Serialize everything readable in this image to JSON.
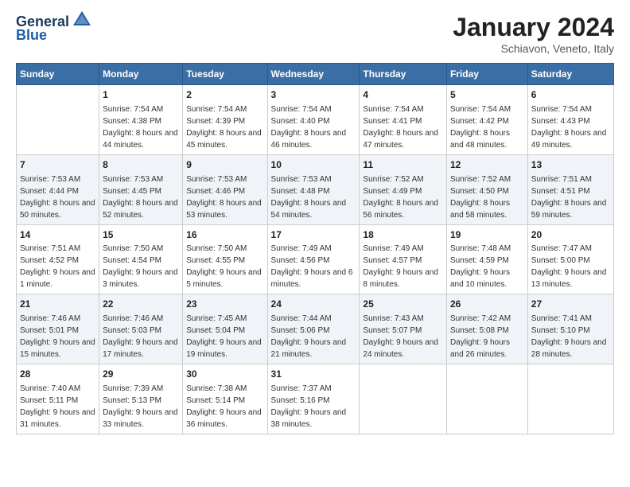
{
  "logo": {
    "line1": "General",
    "line2": "Blue"
  },
  "title": "January 2024",
  "subtitle": "Schiavon, Veneto, Italy",
  "days_of_week": [
    "Sunday",
    "Monday",
    "Tuesday",
    "Wednesday",
    "Thursday",
    "Friday",
    "Saturday"
  ],
  "weeks": [
    [
      {
        "day": "",
        "sunrise": "",
        "sunset": "",
        "daylight": ""
      },
      {
        "day": "1",
        "sunrise": "Sunrise: 7:54 AM",
        "sunset": "Sunset: 4:38 PM",
        "daylight": "Daylight: 8 hours and 44 minutes."
      },
      {
        "day": "2",
        "sunrise": "Sunrise: 7:54 AM",
        "sunset": "Sunset: 4:39 PM",
        "daylight": "Daylight: 8 hours and 45 minutes."
      },
      {
        "day": "3",
        "sunrise": "Sunrise: 7:54 AM",
        "sunset": "Sunset: 4:40 PM",
        "daylight": "Daylight: 8 hours and 46 minutes."
      },
      {
        "day": "4",
        "sunrise": "Sunrise: 7:54 AM",
        "sunset": "Sunset: 4:41 PM",
        "daylight": "Daylight: 8 hours and 47 minutes."
      },
      {
        "day": "5",
        "sunrise": "Sunrise: 7:54 AM",
        "sunset": "Sunset: 4:42 PM",
        "daylight": "Daylight: 8 hours and 48 minutes."
      },
      {
        "day": "6",
        "sunrise": "Sunrise: 7:54 AM",
        "sunset": "Sunset: 4:43 PM",
        "daylight": "Daylight: 8 hours and 49 minutes."
      }
    ],
    [
      {
        "day": "7",
        "sunrise": "Sunrise: 7:53 AM",
        "sunset": "Sunset: 4:44 PM",
        "daylight": "Daylight: 8 hours and 50 minutes."
      },
      {
        "day": "8",
        "sunrise": "Sunrise: 7:53 AM",
        "sunset": "Sunset: 4:45 PM",
        "daylight": "Daylight: 8 hours and 52 minutes."
      },
      {
        "day": "9",
        "sunrise": "Sunrise: 7:53 AM",
        "sunset": "Sunset: 4:46 PM",
        "daylight": "Daylight: 8 hours and 53 minutes."
      },
      {
        "day": "10",
        "sunrise": "Sunrise: 7:53 AM",
        "sunset": "Sunset: 4:48 PM",
        "daylight": "Daylight: 8 hours and 54 minutes."
      },
      {
        "day": "11",
        "sunrise": "Sunrise: 7:52 AM",
        "sunset": "Sunset: 4:49 PM",
        "daylight": "Daylight: 8 hours and 56 minutes."
      },
      {
        "day": "12",
        "sunrise": "Sunrise: 7:52 AM",
        "sunset": "Sunset: 4:50 PM",
        "daylight": "Daylight: 8 hours and 58 minutes."
      },
      {
        "day": "13",
        "sunrise": "Sunrise: 7:51 AM",
        "sunset": "Sunset: 4:51 PM",
        "daylight": "Daylight: 8 hours and 59 minutes."
      }
    ],
    [
      {
        "day": "14",
        "sunrise": "Sunrise: 7:51 AM",
        "sunset": "Sunset: 4:52 PM",
        "daylight": "Daylight: 9 hours and 1 minute."
      },
      {
        "day": "15",
        "sunrise": "Sunrise: 7:50 AM",
        "sunset": "Sunset: 4:54 PM",
        "daylight": "Daylight: 9 hours and 3 minutes."
      },
      {
        "day": "16",
        "sunrise": "Sunrise: 7:50 AM",
        "sunset": "Sunset: 4:55 PM",
        "daylight": "Daylight: 9 hours and 5 minutes."
      },
      {
        "day": "17",
        "sunrise": "Sunrise: 7:49 AM",
        "sunset": "Sunset: 4:56 PM",
        "daylight": "Daylight: 9 hours and 6 minutes."
      },
      {
        "day": "18",
        "sunrise": "Sunrise: 7:49 AM",
        "sunset": "Sunset: 4:57 PM",
        "daylight": "Daylight: 9 hours and 8 minutes."
      },
      {
        "day": "19",
        "sunrise": "Sunrise: 7:48 AM",
        "sunset": "Sunset: 4:59 PM",
        "daylight": "Daylight: 9 hours and 10 minutes."
      },
      {
        "day": "20",
        "sunrise": "Sunrise: 7:47 AM",
        "sunset": "Sunset: 5:00 PM",
        "daylight": "Daylight: 9 hours and 13 minutes."
      }
    ],
    [
      {
        "day": "21",
        "sunrise": "Sunrise: 7:46 AM",
        "sunset": "Sunset: 5:01 PM",
        "daylight": "Daylight: 9 hours and 15 minutes."
      },
      {
        "day": "22",
        "sunrise": "Sunrise: 7:46 AM",
        "sunset": "Sunset: 5:03 PM",
        "daylight": "Daylight: 9 hours and 17 minutes."
      },
      {
        "day": "23",
        "sunrise": "Sunrise: 7:45 AM",
        "sunset": "Sunset: 5:04 PM",
        "daylight": "Daylight: 9 hours and 19 minutes."
      },
      {
        "day": "24",
        "sunrise": "Sunrise: 7:44 AM",
        "sunset": "Sunset: 5:06 PM",
        "daylight": "Daylight: 9 hours and 21 minutes."
      },
      {
        "day": "25",
        "sunrise": "Sunrise: 7:43 AM",
        "sunset": "Sunset: 5:07 PM",
        "daylight": "Daylight: 9 hours and 24 minutes."
      },
      {
        "day": "26",
        "sunrise": "Sunrise: 7:42 AM",
        "sunset": "Sunset: 5:08 PM",
        "daylight": "Daylight: 9 hours and 26 minutes."
      },
      {
        "day": "27",
        "sunrise": "Sunrise: 7:41 AM",
        "sunset": "Sunset: 5:10 PM",
        "daylight": "Daylight: 9 hours and 28 minutes."
      }
    ],
    [
      {
        "day": "28",
        "sunrise": "Sunrise: 7:40 AM",
        "sunset": "Sunset: 5:11 PM",
        "daylight": "Daylight: 9 hours and 31 minutes."
      },
      {
        "day": "29",
        "sunrise": "Sunrise: 7:39 AM",
        "sunset": "Sunset: 5:13 PM",
        "daylight": "Daylight: 9 hours and 33 minutes."
      },
      {
        "day": "30",
        "sunrise": "Sunrise: 7:38 AM",
        "sunset": "Sunset: 5:14 PM",
        "daylight": "Daylight: 9 hours and 36 minutes."
      },
      {
        "day": "31",
        "sunrise": "Sunrise: 7:37 AM",
        "sunset": "Sunset: 5:16 PM",
        "daylight": "Daylight: 9 hours and 38 minutes."
      },
      {
        "day": "",
        "sunrise": "",
        "sunset": "",
        "daylight": ""
      },
      {
        "day": "",
        "sunrise": "",
        "sunset": "",
        "daylight": ""
      },
      {
        "day": "",
        "sunrise": "",
        "sunset": "",
        "daylight": ""
      }
    ]
  ]
}
